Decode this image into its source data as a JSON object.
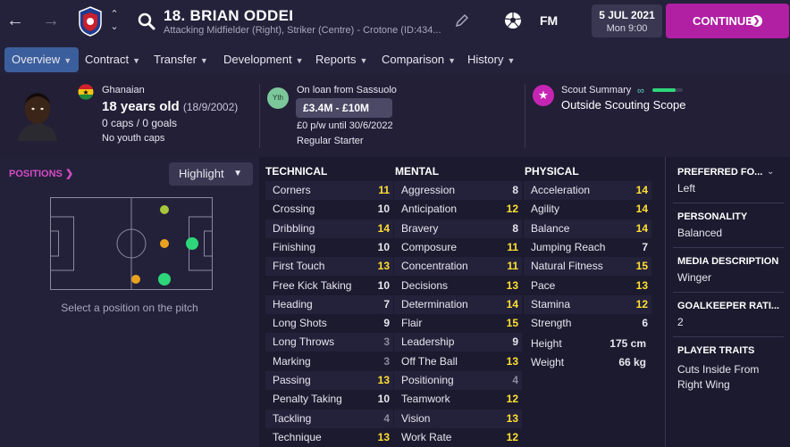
{
  "header": {
    "player_name": "18. BRIAN ODDEI",
    "player_sub": "Attacking Midfielder (Right), Striker (Centre) - Crotone (ID:434...",
    "fm_logo": "FM",
    "date": "5 JUL 2021",
    "time": "Mon 9:00",
    "continue_label": "CONTINUE"
  },
  "tabs": [
    {
      "label": "Overview"
    },
    {
      "label": "Contract"
    },
    {
      "label": "Transfer"
    },
    {
      "label": "Development"
    },
    {
      "label": "Reports"
    },
    {
      "label": "Comparison"
    },
    {
      "label": "History"
    }
  ],
  "profile": {
    "nationality": "Ghanaian",
    "age": "18 years old",
    "dob": "(18/9/2002)",
    "caps": "0 caps / 0 goals",
    "youth_caps": "No youth caps",
    "yth_badge": "Yth",
    "loan": "On loan from Sassuolo",
    "value": "£3.4M - £10M",
    "wage": "£0 p/w until 30/6/2022",
    "status": "Regular Starter",
    "scout_title": "Scout Summary",
    "scout_scope": "Outside Scouting Scope",
    "scout_knowledge": 0.75
  },
  "positions": {
    "link": "POSITIONS",
    "highlight": "Highlight",
    "hint": "Select a position on the pitch"
  },
  "technical": {
    "title": "TECHNICAL",
    "rows": [
      {
        "name": "Corners",
        "value": "11"
      },
      {
        "name": "Crossing",
        "value": "10"
      },
      {
        "name": "Dribbling",
        "value": "14"
      },
      {
        "name": "Finishing",
        "value": "10"
      },
      {
        "name": "First Touch",
        "value": "13"
      },
      {
        "name": "Free Kick Taking",
        "value": "10"
      },
      {
        "name": "Heading",
        "value": "7"
      },
      {
        "name": "Long Shots",
        "value": "9"
      },
      {
        "name": "Long Throws",
        "value": "3"
      },
      {
        "name": "Marking",
        "value": "3"
      },
      {
        "name": "Passing",
        "value": "13"
      },
      {
        "name": "Penalty Taking",
        "value": "10"
      },
      {
        "name": "Tackling",
        "value": "4"
      },
      {
        "name": "Technique",
        "value": "13"
      }
    ]
  },
  "mental": {
    "title": "MENTAL",
    "rows": [
      {
        "name": "Aggression",
        "value": "8"
      },
      {
        "name": "Anticipation",
        "value": "12"
      },
      {
        "name": "Bravery",
        "value": "8"
      },
      {
        "name": "Composure",
        "value": "11"
      },
      {
        "name": "Concentration",
        "value": "11"
      },
      {
        "name": "Decisions",
        "value": "13"
      },
      {
        "name": "Determination",
        "value": "14"
      },
      {
        "name": "Flair",
        "value": "15"
      },
      {
        "name": "Leadership",
        "value": "9"
      },
      {
        "name": "Off The Ball",
        "value": "13"
      },
      {
        "name": "Positioning",
        "value": "4"
      },
      {
        "name": "Teamwork",
        "value": "12"
      },
      {
        "name": "Vision",
        "value": "13"
      },
      {
        "name": "Work Rate",
        "value": "12"
      }
    ]
  },
  "physical": {
    "title": "PHYSICAL",
    "rows": [
      {
        "name": "Acceleration",
        "value": "14"
      },
      {
        "name": "Agility",
        "value": "14"
      },
      {
        "name": "Balance",
        "value": "14"
      },
      {
        "name": "Jumping Reach",
        "value": "7"
      },
      {
        "name": "Natural Fitness",
        "value": "15"
      },
      {
        "name": "Pace",
        "value": "13"
      },
      {
        "name": "Stamina",
        "value": "12"
      },
      {
        "name": "Strength",
        "value": "6"
      }
    ],
    "height_label": "Height",
    "height": "175 cm",
    "weight_label": "Weight",
    "weight": "66 kg"
  },
  "sidebar": {
    "preferred_foot_label": "PREFERRED FO...",
    "preferred_foot": "Left",
    "personality_label": "PERSONALITY",
    "personality": "Balanced",
    "media_label": "MEDIA DESCRIPTION",
    "media": "Winger",
    "gk_label": "GOALKEEPER RATI...",
    "gk": "2",
    "traits_label": "PLAYER TRAITS",
    "traits": "Cuts Inside From Right Wing"
  },
  "colors": {
    "accent": "#b11fa3",
    "tab_active": "#3b5f9c",
    "value_good": "#ffe033",
    "value_low": "#8c899e",
    "pos_natural": "#2ed67a",
    "pos_accomplished": "#a8c63a",
    "pos_unconvincing": "#e8a21e"
  }
}
